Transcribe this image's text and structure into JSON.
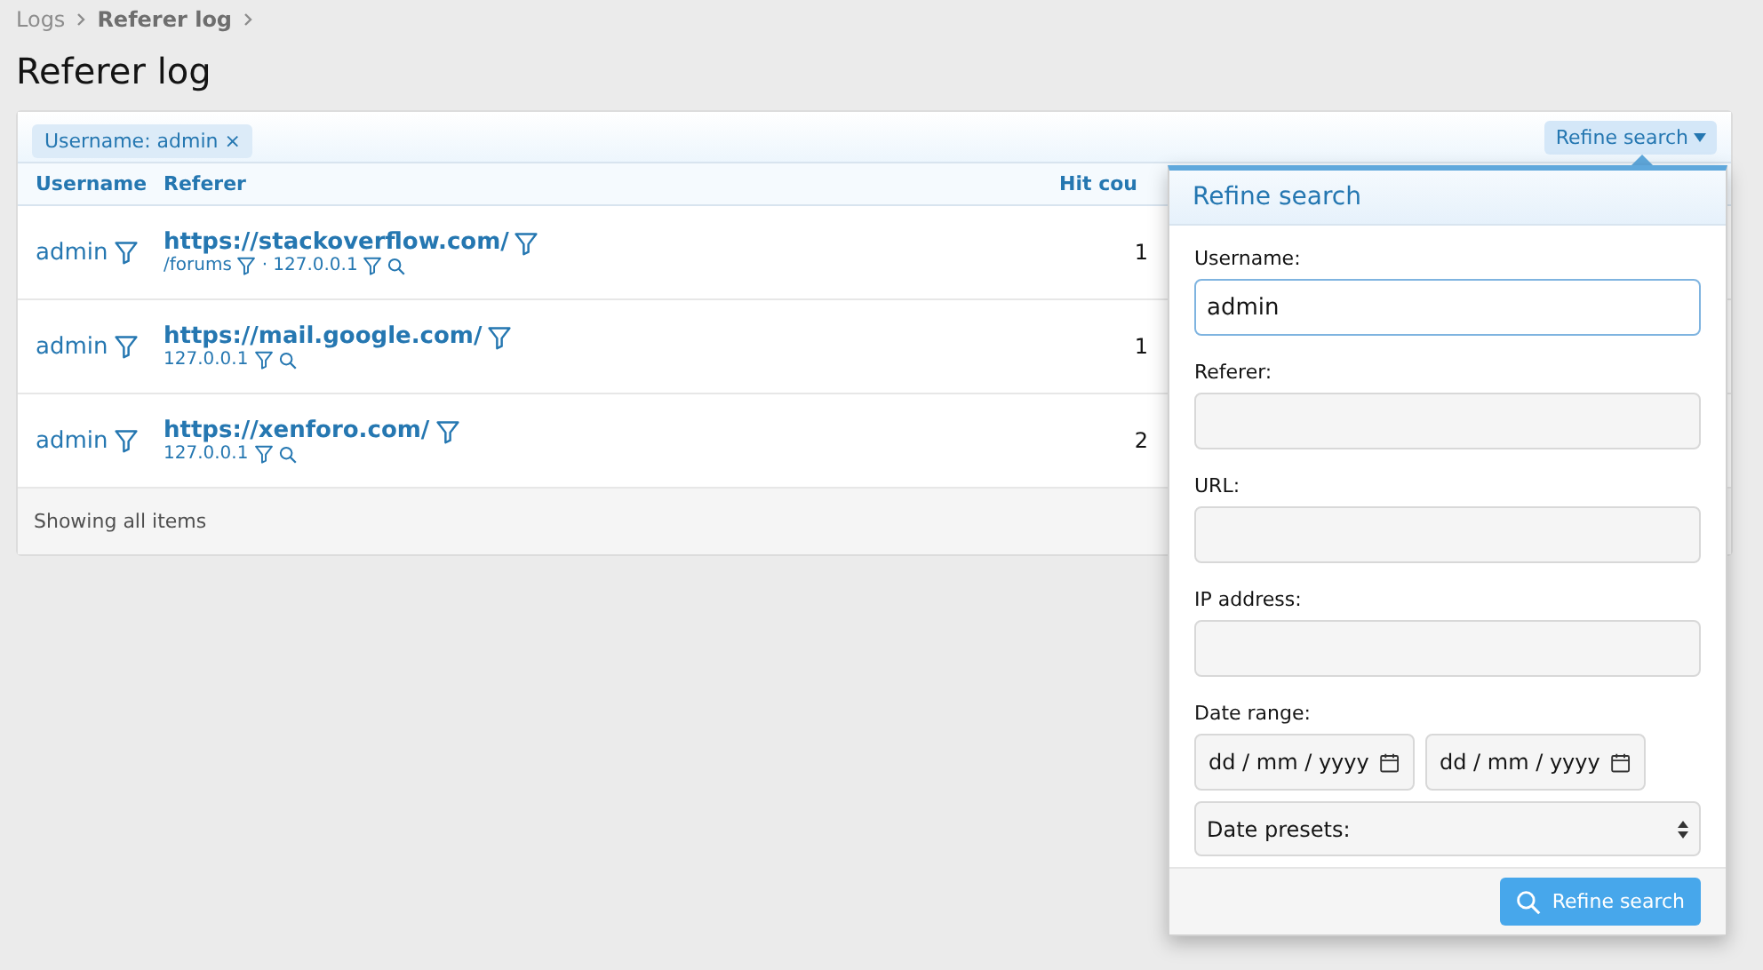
{
  "breadcrumb": [
    {
      "label": "Logs",
      "current": false
    },
    {
      "label": "Referer log",
      "current": true
    }
  ],
  "title": "Referer log",
  "filters": [
    {
      "label": "Username: admin",
      "remove": "×"
    }
  ],
  "refine_button": "Refine search",
  "table": {
    "columns": [
      "Username",
      "Referer",
      "Hit cou"
    ],
    "rows": [
      {
        "username": "admin",
        "referer": "https://stackoverflow.com/",
        "details": [
          {
            "kind": "link",
            "text": "/forums"
          },
          {
            "kind": "separator",
            "text": "·"
          },
          {
            "kind": "link",
            "text": "127.0.0.1",
            "search": true
          }
        ],
        "hits": "1"
      },
      {
        "username": "admin",
        "referer": "https://mail.google.com/",
        "details": [
          {
            "kind": "link",
            "text": "127.0.0.1",
            "search": true
          }
        ],
        "hits": "1"
      },
      {
        "username": "admin",
        "referer": "https://xenforo.com/",
        "details": [
          {
            "kind": "link",
            "text": "127.0.0.1",
            "search": true
          }
        ],
        "hits": "2"
      }
    ],
    "footer": "Showing all items"
  },
  "popup": {
    "title": "Refine search",
    "fields": [
      {
        "kind": "text",
        "label": "Username:",
        "value": "admin",
        "focused": true
      },
      {
        "kind": "text",
        "label": "Referer:",
        "focused": false
      },
      {
        "kind": "text",
        "label": "URL:",
        "focused": false
      },
      {
        "kind": "text",
        "label": "IP address:",
        "focused": false
      },
      {
        "kind": "daterange",
        "label": "Date range:",
        "placeholders": [
          "dd / mm / yyyy",
          "dd / mm / yyyy"
        ],
        "preset": "Date presets:"
      }
    ],
    "submit": "Refine search"
  }
}
